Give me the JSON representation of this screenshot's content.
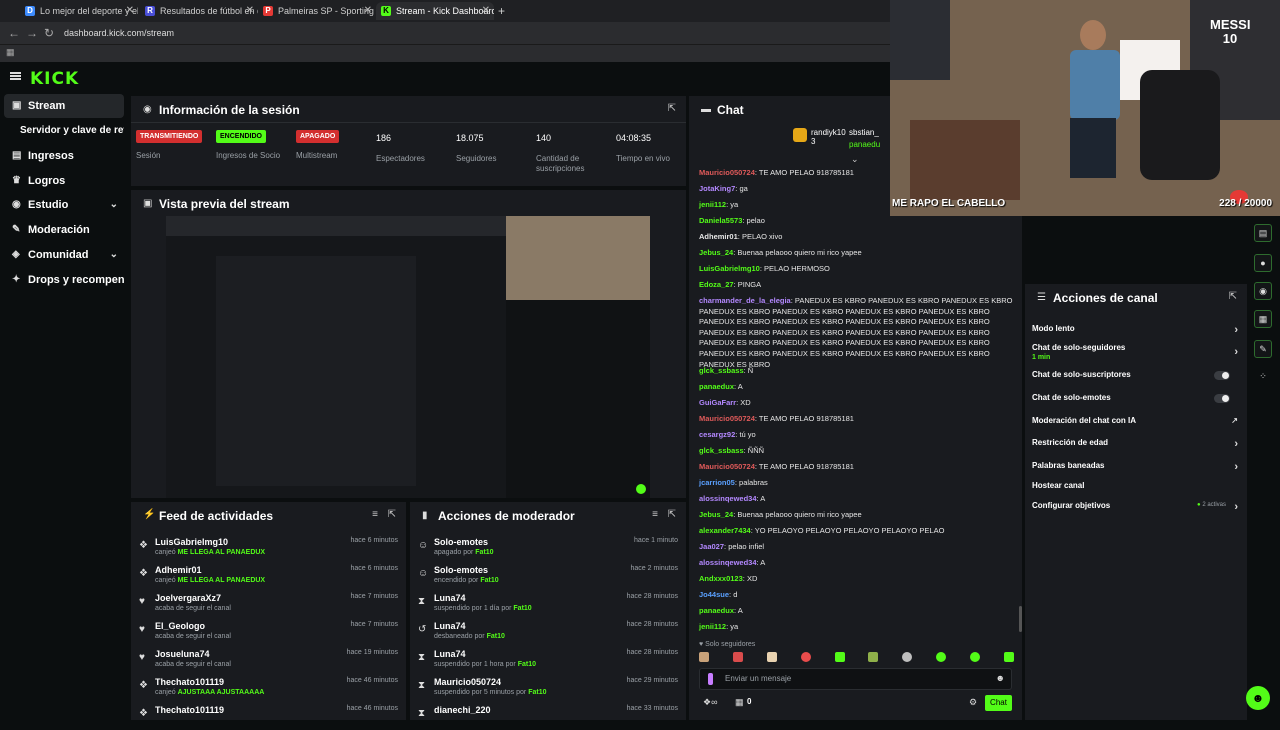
{
  "browser": {
    "tabs": [
      {
        "label": "Lo mejor del deporte y el entre",
        "icon": "D",
        "color": "#3d8bfd"
      },
      {
        "label": "Resultados de fútbol en directo",
        "icon": "R",
        "color": "#4a4fd8"
      },
      {
        "label": "Palmeiras SP - Sporting Cristal",
        "icon": "P",
        "color": "#e53935"
      },
      {
        "label": "Stream - Kick Dashboard",
        "icon": "K",
        "color": "#53fc18"
      }
    ],
    "new_tab": "+",
    "url": "dashboard.kick.com/stream"
  },
  "app": {
    "logo": "KICK",
    "accent": "#53fc18"
  },
  "sidebar": {
    "items": [
      {
        "label": "Stream",
        "icon": "video-icon"
      },
      {
        "label": "Servidor y clave de retransmisión",
        "icon": ""
      },
      {
        "label": "Ingresos",
        "icon": "money-icon"
      },
      {
        "label": "Logros",
        "icon": "trophy-icon"
      },
      {
        "label": "Estudio",
        "icon": "studio-icon"
      },
      {
        "label": "Moderación",
        "icon": "wrench-icon"
      },
      {
        "label": "Comunidad",
        "icon": "community-icon"
      },
      {
        "label": "Drops y recompensas",
        "icon": "gift-icon"
      }
    ]
  },
  "session": {
    "title": "Información de la sesión",
    "stats": [
      {
        "badge": "TRANSMITIENDO",
        "badge_color": "#d32f2f",
        "label": "Sesión"
      },
      {
        "badge": "ENCENDIDO",
        "badge_color": "#53fc18",
        "label": "Ingresos de Socio"
      },
      {
        "badge": "APAGADO",
        "badge_color": "#d32f2f",
        "label": "Multistream"
      },
      {
        "value": "186",
        "label": "Espectadores"
      },
      {
        "value": "18.075",
        "label": "Seguidores"
      },
      {
        "value": "140",
        "label": "Cantidad de suscripciones"
      },
      {
        "value": "04:08:35",
        "label": "Tiempo en vivo"
      }
    ]
  },
  "preview": {
    "title": "Vista previa del stream"
  },
  "feed": {
    "title": "Feed de actividades",
    "rows": [
      {
        "name": "LuisGabrielmg10",
        "sub": "canjeó",
        "highlight": "ME LLEGA AL PANAEDUX",
        "time": "hace 6 minutos",
        "icon": "redeem-icon"
      },
      {
        "name": "Adhemir01",
        "sub": "canjeó",
        "highlight": "ME LLEGA AL PANAEDUX",
        "time": "hace 6 minutos",
        "icon": "redeem-icon"
      },
      {
        "name": "JoelvergaraXz7",
        "sub": "acaba de seguir el canal",
        "highlight": "",
        "time": "hace 7 minutos",
        "icon": "heart-icon"
      },
      {
        "name": "El_Geologo",
        "sub": "acaba de seguir el canal",
        "highlight": "",
        "time": "hace 7 minutos",
        "icon": "heart-icon"
      },
      {
        "name": "Josueluna74",
        "sub": "acaba de seguir el canal",
        "highlight": "",
        "time": "hace 19 minutos",
        "icon": "heart-icon"
      },
      {
        "name": "Thechato101119",
        "sub": "canjeó",
        "highlight": "AJUSTAAA AJUSTAAAAA",
        "time": "hace 46 minutos",
        "icon": "redeem-icon"
      },
      {
        "name": "Thechato101119",
        "sub": "",
        "highlight": "",
        "time": "hace 46 minutos",
        "icon": "redeem-icon"
      }
    ]
  },
  "modactions": {
    "title": "Acciones de moderador",
    "rows": [
      {
        "name": "Solo-emotes",
        "sub": "apagado por",
        "by": "Fat10",
        "time": "hace 1 minuto",
        "icon": "emote-icon"
      },
      {
        "name": "Solo-emotes",
        "sub": "encendido por",
        "by": "Fat10",
        "time": "hace 2 minutos",
        "icon": "emote-icon"
      },
      {
        "name": "Luna74",
        "sub": "suspendido por 1 día por",
        "by": "Fat10",
        "time": "hace 28 minutos",
        "icon": "hourglass-icon"
      },
      {
        "name": "Luna74",
        "sub": "desbaneado por",
        "by": "Fat10",
        "time": "hace 28 minutos",
        "icon": "unban-icon"
      },
      {
        "name": "Luna74",
        "sub": "suspendido por 1 hora por",
        "by": "Fat10",
        "time": "hace 28 minutos",
        "icon": "hourglass-icon"
      },
      {
        "name": "Mauricio050724",
        "sub": "suspendido por 5 minutos por",
        "by": "Fat10",
        "time": "hace 29 minutos",
        "icon": "hourglass-icon"
      },
      {
        "name": "dianechi_220",
        "sub": "",
        "by": "",
        "time": "hace 33 minutos",
        "icon": "hourglass-icon"
      }
    ]
  },
  "chat": {
    "title": "Chat",
    "top_users": [
      {
        "name": "randiyk10",
        "count": "3"
      },
      {
        "name": "sbstian_"
      },
      {
        "name": "panaedu"
      }
    ],
    "messages": [
      {
        "user": "Mauricio050724",
        "color": "#e05a5a",
        "text": "TE AMO PELAO 918785181"
      },
      {
        "user": "JotaKing7",
        "color": "#b388ff",
        "text": "ga"
      },
      {
        "user": "jenii112",
        "color": "#53fc18",
        "text": "ya"
      },
      {
        "user": "Daniela5573",
        "color": "#53fc18",
        "text": "pelao"
      },
      {
        "user": "Adhemir01",
        "color": "#e6e6e6",
        "text": "PELAO xivo"
      },
      {
        "user": "Jebus_24",
        "color": "#53fc18",
        "text": "Buenaa pelaooo quiero mi rico yapee"
      },
      {
        "user": "LuisGabrielmg10",
        "color": "#53fc18",
        "text": "PELAO HERMOSO"
      },
      {
        "user": "Edoza_27",
        "color": "#53fc18",
        "text": "PINGA"
      },
      {
        "user": "charmander_de_la_elegia",
        "color": "#b388ff",
        "text": "PANEDUX ES KBRO PANEDUX ES KBRO PANEDUX ES KBRO PANEDUX ES KBRO PANEDUX ES KBRO PANEDUX ES KBRO PANEDUX ES KBRO PANEDUX ES KBRO PANEDUX ES KBRO PANEDUX ES KBRO PANEDUX ES KBRO PANEDUX ES KBRO PANEDUX ES KBRO PANEDUX ES KBRO PANEDUX ES KBRO PANEDUX ES KBRO PANEDUX ES KBRO PANEDUX ES KBRO PANEDUX ES KBRO PANEDUX ES KBRO PANEDUX ES KBRO PANEDUX ES KBRO PANEDUX ES KBRO PANEDUX ES KBRO"
      },
      {
        "user": "glck_ssbass",
        "color": "#53fc18",
        "text": "Ñ"
      },
      {
        "user": "panaedux",
        "color": "#53fc18",
        "text": "A"
      },
      {
        "user": "GuiGaFarr",
        "color": "#b388ff",
        "text": "XD"
      },
      {
        "user": "Mauricio050724",
        "color": "#e05a5a",
        "text": "TE AMO PELAO 918785181"
      },
      {
        "user": "cesargz92",
        "color": "#b388ff",
        "text": "tú yo"
      },
      {
        "user": "glck_ssbass",
        "color": "#53fc18",
        "text": "ÑÑÑ"
      },
      {
        "user": "Mauricio050724",
        "color": "#e05a5a",
        "text": "TE AMO PELAO 918785181"
      },
      {
        "user": "jcarrion05",
        "color": "#5aa0ff",
        "text": "palabras"
      },
      {
        "user": "alossinqewed34",
        "color": "#b388ff",
        "text": "A"
      },
      {
        "user": "Jebus_24",
        "color": "#53fc18",
        "text": "Buenaa pelaooo quiero mi rico yapee"
      },
      {
        "user": "alexander7434",
        "color": "#53fc18",
        "text": "YO PELAOYO PELAOYO PELAOYO PELAOYO PELAO"
      },
      {
        "user": "Jaa027",
        "color": "#b388ff",
        "text": "pelao infiel"
      },
      {
        "user": "alossinqewed34",
        "color": "#b388ff",
        "text": "A"
      },
      {
        "user": "Andxxx0123",
        "color": "#53fc18",
        "text": "XD"
      },
      {
        "user": "Jo44sue",
        "color": "#5aa0ff",
        "text": "d"
      },
      {
        "user": "panaedux",
        "color": "#53fc18",
        "text": "A"
      },
      {
        "user": "jenii112",
        "color": "#53fc18",
        "text": "ya"
      }
    ],
    "followers_only": "Solo seguidores",
    "input_placeholder": "Enviar un mensaje",
    "viewer_count": "0",
    "send_label": "Chat"
  },
  "webcam": {
    "overlay_text": "ME RAPO EL CABELLO",
    "counter": "228 / 20000",
    "jersey": "MESSI 10"
  },
  "channel_actions": {
    "title": "Acciones de canal",
    "rows": [
      {
        "label": "Modo lento",
        "control": "chevron"
      },
      {
        "label": "Chat de solo-seguidores",
        "sub": "1 min",
        "control": "chevron"
      },
      {
        "label": "Chat de solo-suscriptores",
        "control": "toggle"
      },
      {
        "label": "Chat de solo-emotes",
        "control": "toggle"
      },
      {
        "label": "Moderación del chat con IA",
        "control": "external"
      },
      {
        "label": "Restricción de edad",
        "control": "chevron"
      },
      {
        "label": "Palabras baneadas",
        "control": "chevron"
      },
      {
        "label": "Hostear canal",
        "control": "none"
      },
      {
        "label": "Configurar objetivos",
        "badge": "2 activas",
        "control": "chevron"
      }
    ]
  }
}
